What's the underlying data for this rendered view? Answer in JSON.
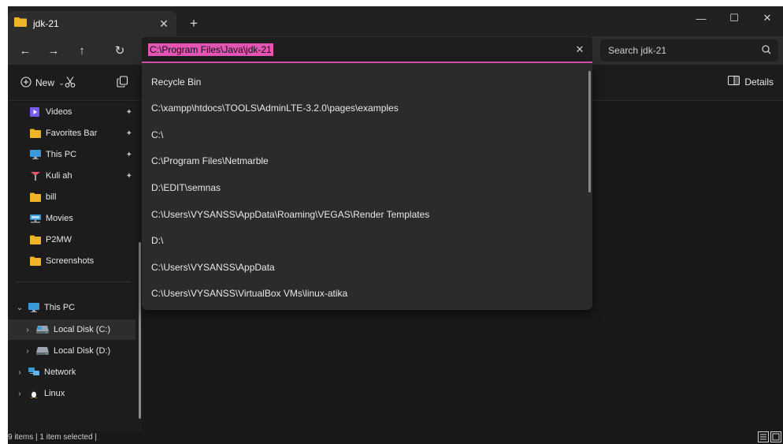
{
  "tab": {
    "title": "jdk-21",
    "close_label": "✕",
    "new_tab_label": "+"
  },
  "window_controls": {
    "minimize": "—",
    "maximize": "☐",
    "close": "✕"
  },
  "address_bar": {
    "value": "C:\\Program Files\\Java\\jdk-21",
    "clear_label": "✕"
  },
  "search": {
    "placeholder": "Search jdk-21"
  },
  "toolbar": {
    "new_label": "New",
    "new_chevron": "⌄",
    "details_label": "Details"
  },
  "sidebar": {
    "quick_access": [
      {
        "label": "Videos",
        "icon": "video-folder-icon",
        "pinned": true
      },
      {
        "label": "Favorites Bar",
        "icon": "folder-icon",
        "pinned": true
      },
      {
        "label": "This PC",
        "icon": "computer-icon",
        "pinned": true
      },
      {
        "label": "Kuli ah",
        "icon": "app-icon",
        "pinned": true
      },
      {
        "label": "bill",
        "icon": "folder-icon",
        "pinned": false
      },
      {
        "label": "Movies",
        "icon": "network-drive-icon",
        "pinned": false
      },
      {
        "label": "P2MW",
        "icon": "folder-icon",
        "pinned": false
      },
      {
        "label": "Screenshots",
        "icon": "folder-icon",
        "pinned": false
      }
    ],
    "this_pc": {
      "label": "This PC"
    },
    "drives": [
      {
        "label": "Local Disk (C:)",
        "selected": true
      },
      {
        "label": "Local Disk (D:)",
        "selected": false
      }
    ],
    "network": {
      "label": "Network"
    },
    "linux": {
      "label": "Linux"
    }
  },
  "address_suggestions": [
    "Recycle Bin",
    "C:\\xampp\\htdocs\\TOOLS\\AdminLTE-3.2.0\\pages\\examples",
    "C:\\",
    "C:\\Program Files\\Netmarble",
    "D:\\EDIT\\semnas",
    "C:\\Users\\VYSANSS\\AppData\\Roaming\\VEGAS\\Render Templates",
    "D:\\",
    "C:\\Users\\VYSANSS\\AppData",
    "C:\\Users\\VYSANSS\\VirtualBox VMs\\linux-atika"
  ],
  "status": {
    "text": "9 items  |  1 item selected  |"
  },
  "colors": {
    "accent": "#e354b4",
    "folder": "#f0b429",
    "background": "#191919"
  }
}
